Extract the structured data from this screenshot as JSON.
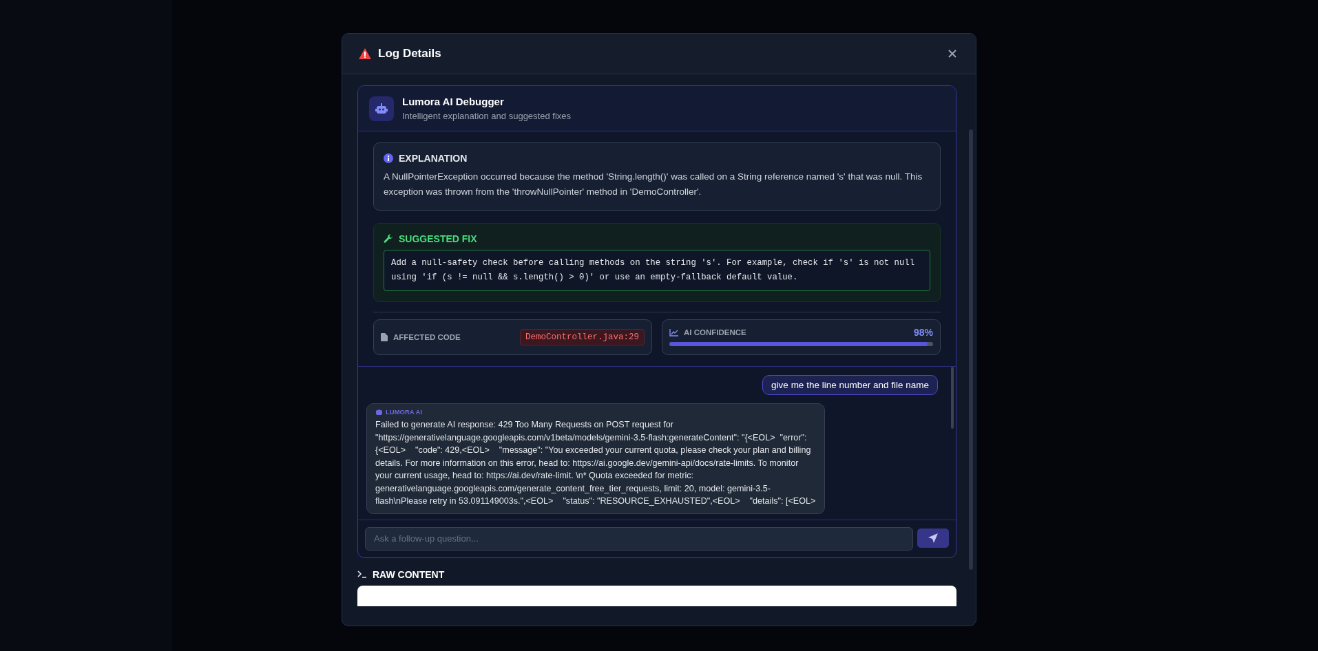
{
  "modal": {
    "title": "Log Details"
  },
  "debugger": {
    "title": "Lumora AI Debugger",
    "subtitle": "Intelligent explanation and suggested fixes",
    "explanation": {
      "heading": "EXPLANATION",
      "text": "A NullPointerException occurred because the method 'String.length()' was called on a String reference named 's' that was null. This exception was thrown from the 'throwNullPointer' method in 'DemoController'."
    },
    "suggested_fix": {
      "heading": "SUGGESTED FIX",
      "text": "Add a null-safety check before calling methods on the string 's'. For example, check if 's' is not null using 'if (s != null && s.length() > 0)' or use an empty-fallback default value."
    },
    "affected_code": {
      "label": "AFFECTED CODE",
      "value": "DemoController.java:29"
    },
    "confidence": {
      "label": "AI CONFIDENCE",
      "reading": "98%",
      "level": 0.98
    }
  },
  "chat": {
    "messages": [
      {
        "kind": "user",
        "text": "give me the line number and file name"
      },
      {
        "kind": "assistant",
        "sender": "LUMORA AI",
        "text": "Failed to generate AI response: 429 Too Many Requests on POST request for \"https://generativelanguage.googleapis.com/v1beta/models/gemini-3.5-flash:generateContent\": \"{<EOL>  \"error\": {<EOL>    \"code\": 429,<EOL>    \"message\": \"You exceeded your current quota, please check your plan and billing details. For more information on this error, head to: https://ai.google.dev/gemini-api/docs/rate-limits. To monitor your current usage, head to: https://ai.dev/rate-limit. \\n* Quota exceeded for metric: generativelanguage.googleapis.com/generate_content_free_tier_requests, limit: 20, model: gemini-3.5-flash\\nPlease retry in 53.091149003s.\",<EOL>    \"status\": \"RESOURCE_EXHAUSTED\",<EOL>    \"details\": [<EOL>"
      }
    ],
    "input": {
      "placeholder": "Ask a follow-up question..."
    }
  },
  "raw_content": {
    "heading": "RAW CONTENT"
  }
}
